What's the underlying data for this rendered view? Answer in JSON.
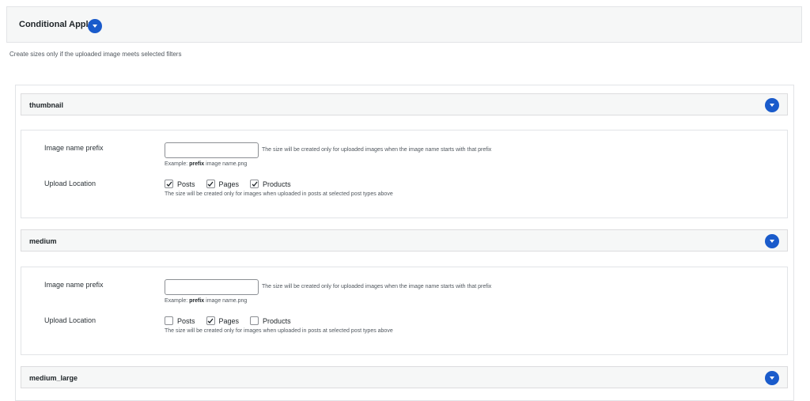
{
  "conditional_apply": {
    "title": "Conditional Apply",
    "description": "Create sizes only if the uploaded image meets selected filters"
  },
  "accent_color": "#1a5bcb",
  "sizes": [
    {
      "name": "thumbnail",
      "expanded": true,
      "prefix_label": "Image name prefix",
      "prefix_value": "",
      "prefix_help": "The size will be created only for uploaded images when the image name starts with that prefix",
      "example_label": "Example:",
      "example_bold": "prefix",
      "example_rest": "image name.png",
      "location_label": "Upload Location",
      "post_types": [
        {
          "label": "Posts",
          "checked": true
        },
        {
          "label": "Pages",
          "checked": true
        },
        {
          "label": "Products",
          "checked": true
        }
      ],
      "location_help": "The size will be created only for images when uploaded in posts at selected post types above"
    },
    {
      "name": "medium",
      "expanded": true,
      "prefix_label": "Image name prefix",
      "prefix_value": "",
      "prefix_help": "The size will be created only for uploaded images when the image name starts with that prefix",
      "example_label": "Example:",
      "example_bold": "prefix",
      "example_rest": "image name.png",
      "location_label": "Upload Location",
      "post_types": [
        {
          "label": "Posts",
          "checked": false
        },
        {
          "label": "Pages",
          "checked": true
        },
        {
          "label": "Products",
          "checked": false
        }
      ],
      "location_help": "The size will be created only for images when uploaded in posts at selected post types above"
    },
    {
      "name": "medium_large",
      "expanded": false
    }
  ]
}
